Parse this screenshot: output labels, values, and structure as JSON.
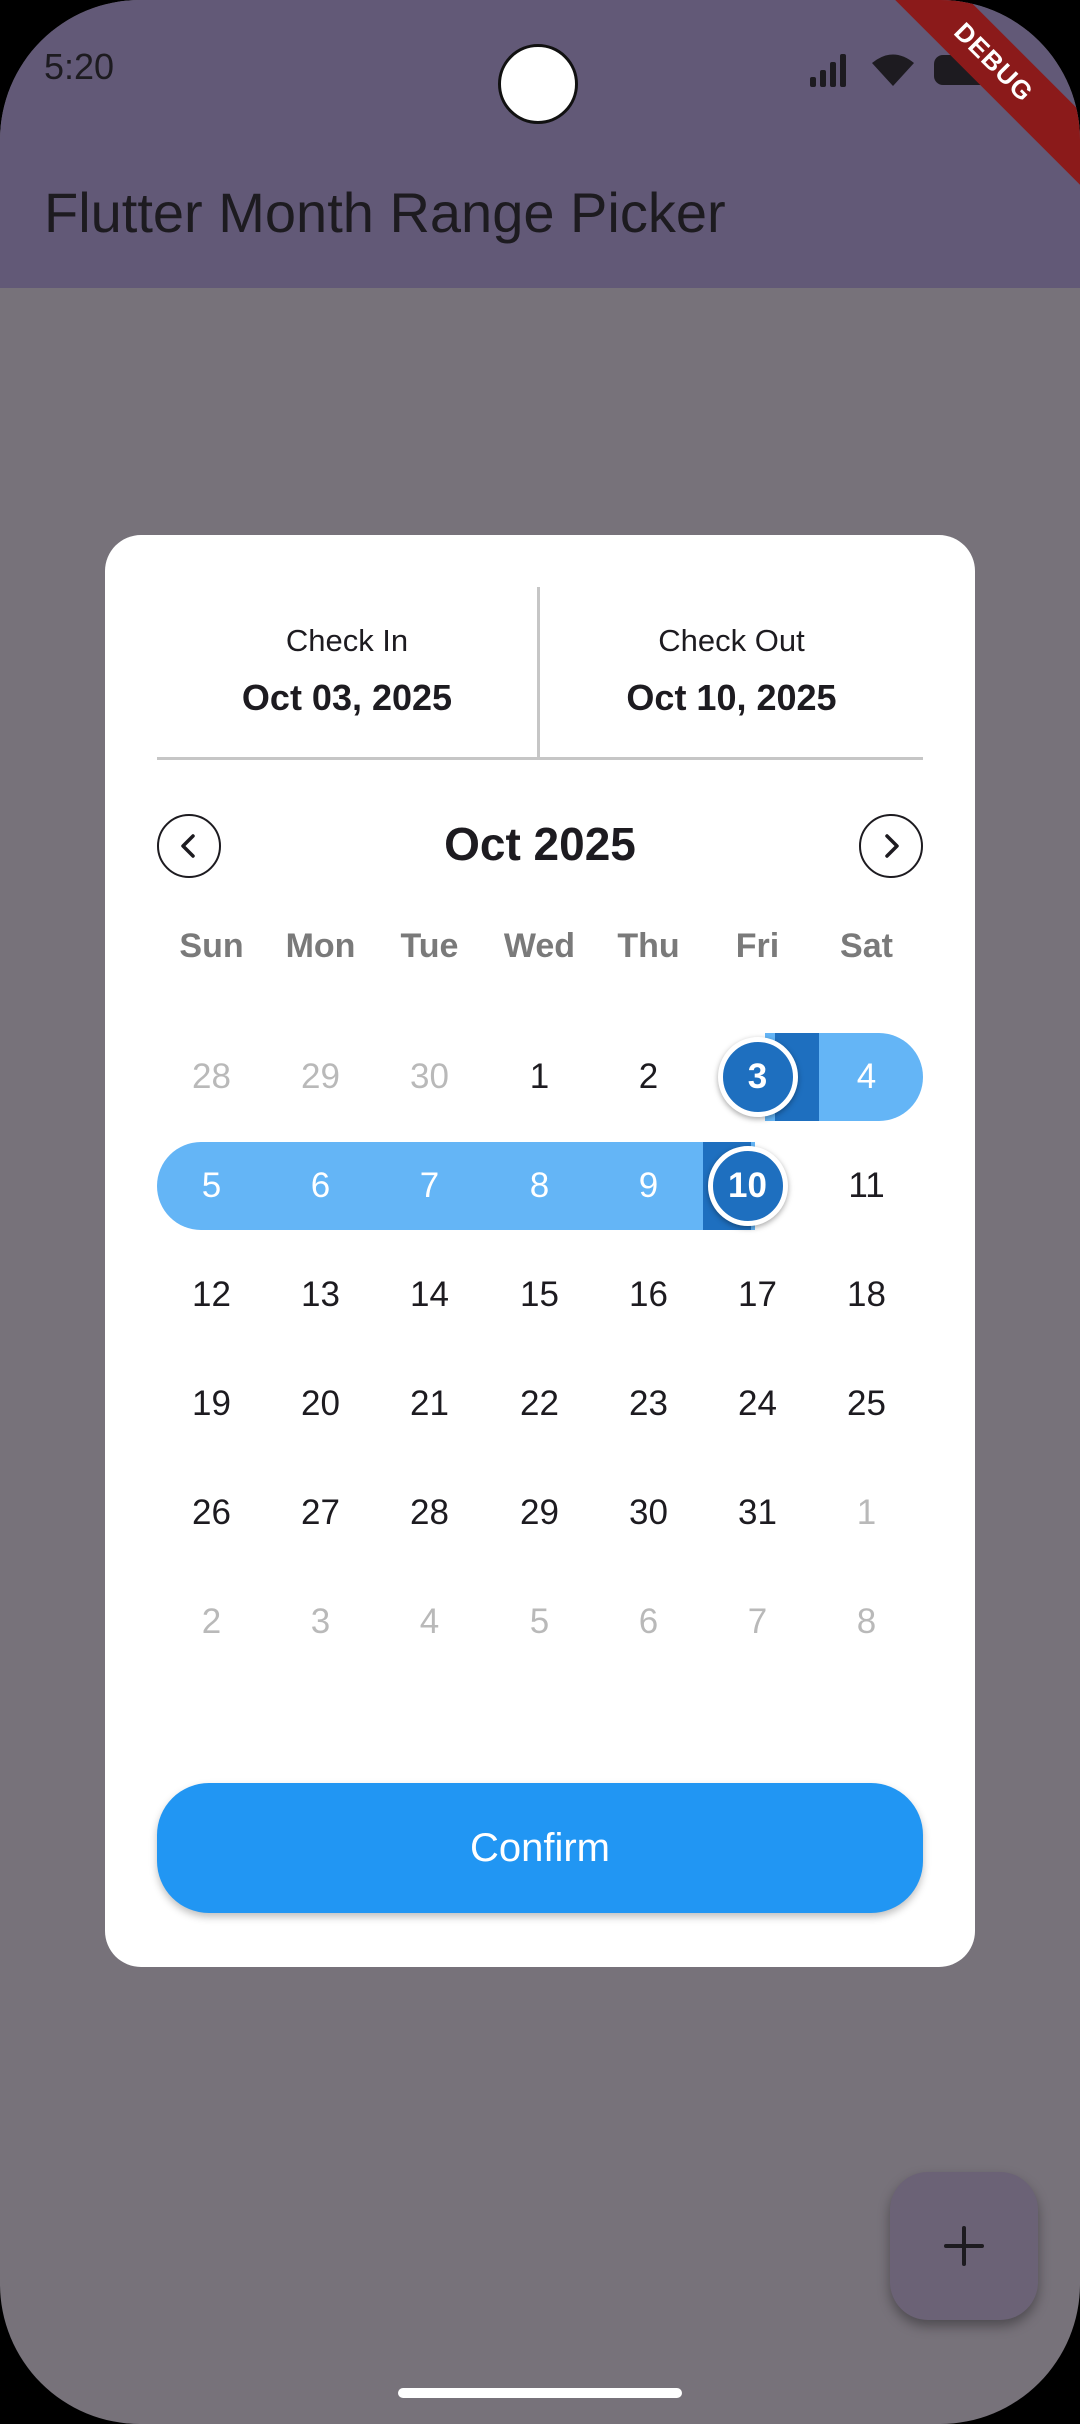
{
  "status_bar": {
    "time": "5:20",
    "icons": [
      "signal-icon",
      "wifi-icon",
      "battery-icon"
    ]
  },
  "app_bar": {
    "title": "Flutter Month Range Picker",
    "banner": "DEBUG"
  },
  "picker": {
    "check_in": {
      "label": "Check In",
      "value": "Oct 03, 2025"
    },
    "check_out": {
      "label": "Check Out",
      "value": "Oct 10, 2025"
    },
    "month_title": "Oct 2025",
    "prev_icon": "chevron-left-icon",
    "next_icon": "chevron-right-icon",
    "weekdays": [
      "Sun",
      "Mon",
      "Tue",
      "Wed",
      "Thu",
      "Fri",
      "Sat"
    ],
    "weeks": [
      [
        "28",
        "29",
        "30",
        "1",
        "2",
        "3",
        "4"
      ],
      [
        "5",
        "6",
        "7",
        "8",
        "9",
        "10",
        "11"
      ],
      [
        "12",
        "13",
        "14",
        "15",
        "16",
        "17",
        "18"
      ],
      [
        "19",
        "20",
        "21",
        "22",
        "23",
        "24",
        "25"
      ],
      [
        "26",
        "27",
        "28",
        "29",
        "30",
        "31",
        "1"
      ],
      [
        "2",
        "3",
        "4",
        "5",
        "6",
        "7",
        "8"
      ]
    ],
    "confirm_label": "Confirm"
  },
  "fab": {
    "icon": "plus-icon"
  },
  "colors": {
    "app_bar": "#625977",
    "selected": "#1E6FBF",
    "range": "#64B5F6",
    "confirm": "#2196F3"
  }
}
